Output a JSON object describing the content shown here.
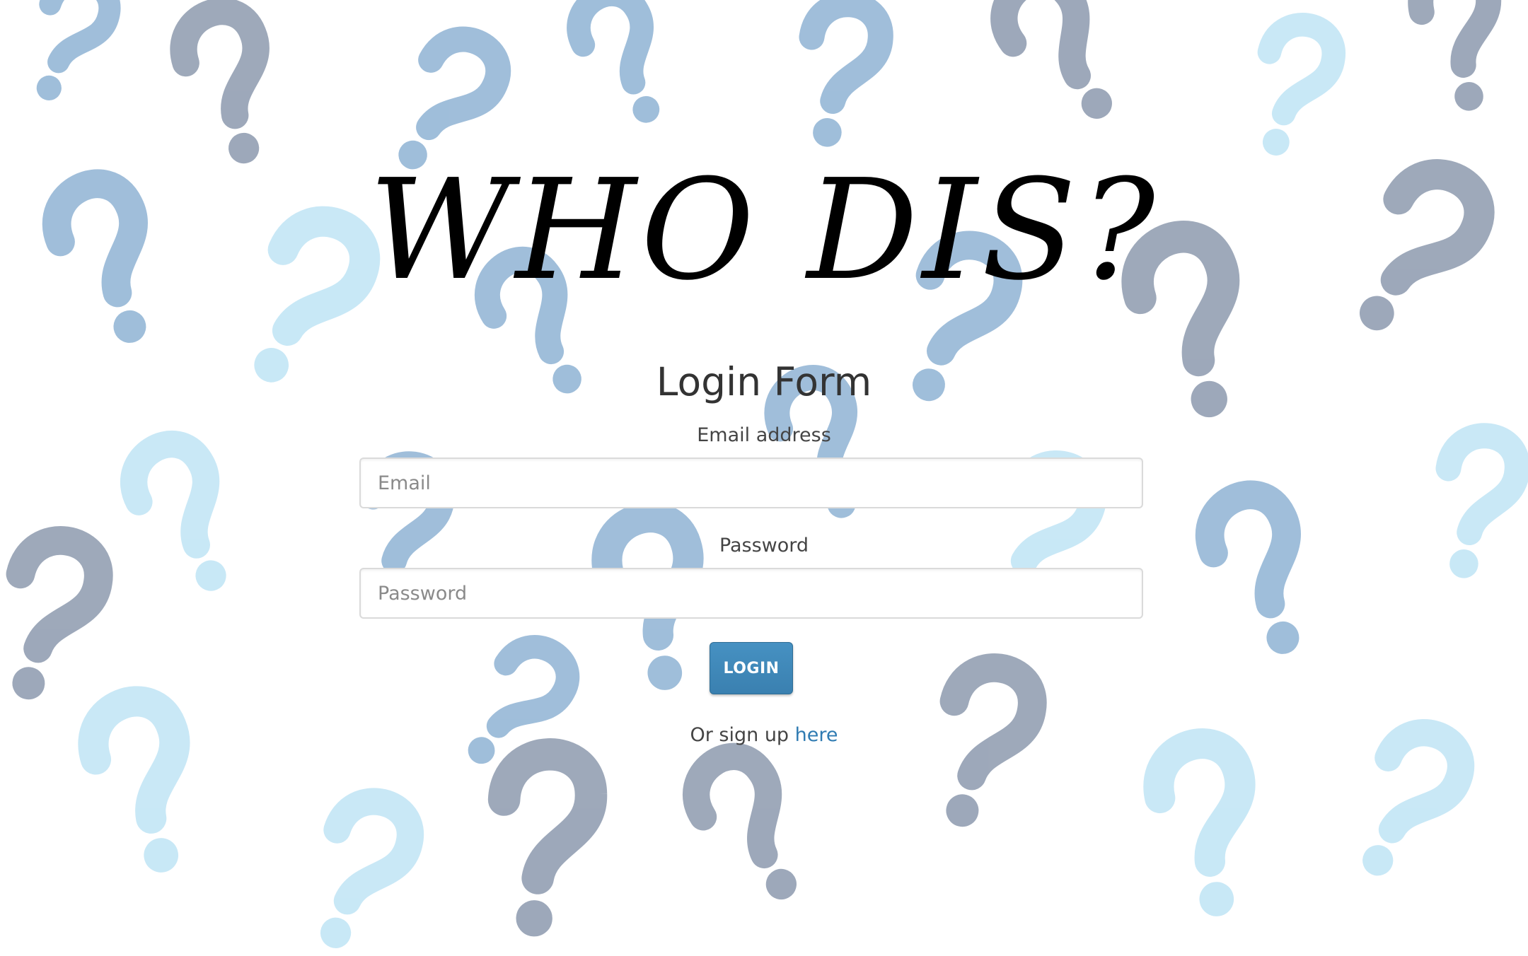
{
  "header": {
    "brand_title": "WHO DIS?"
  },
  "login_form": {
    "heading": "Login Form",
    "email": {
      "label": "Email address",
      "placeholder": "Email",
      "value": ""
    },
    "password": {
      "label": "Password",
      "placeholder": "Password",
      "value": ""
    },
    "submit_label": "LOGIN",
    "signup_prefix": "Or sign up",
    "signup_link_text": "here"
  },
  "colors": {
    "accent": "#3a80b0",
    "link": "#2f7bb2",
    "background_mark_light": "#bfe4f5",
    "background_mark_mid": "#8fb3d4",
    "background_mark_dark": "#8d9aae"
  }
}
